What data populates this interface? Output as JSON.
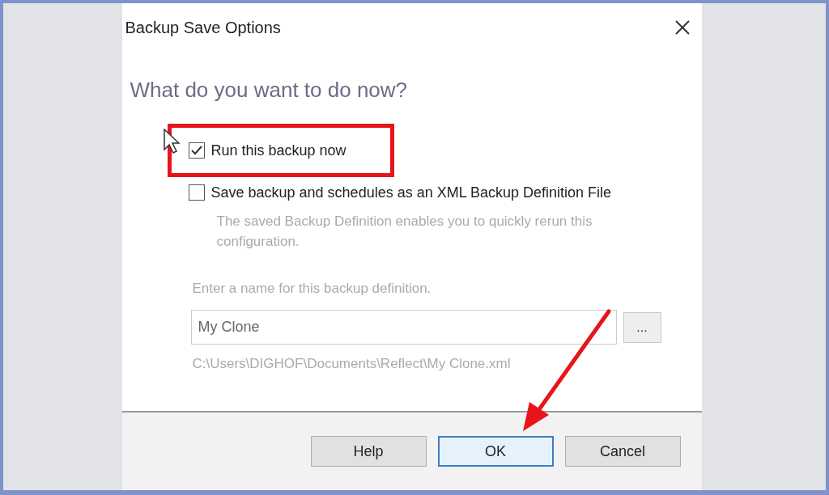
{
  "window": {
    "title": "Backup Save Options"
  },
  "heading": "What do you want to do now?",
  "options": [
    {
      "label": "Run this backup now",
      "checked": true,
      "highlighted": true
    },
    {
      "label": "Save backup and schedules as an XML Backup Definition File",
      "checked": false,
      "highlighted": false
    }
  ],
  "description": "The saved Backup Definition enables you to quickly rerun this configuration.",
  "name_field": {
    "label": "Enter a name for this backup definition.",
    "value": "My Clone",
    "browse": "..."
  },
  "path": "C:\\Users\\DIGHOF\\Documents\\Reflect\\My Clone.xml",
  "buttons": [
    {
      "label": "Help",
      "focused": false
    },
    {
      "label": "OK",
      "focused": true
    },
    {
      "label": "Cancel",
      "focused": false
    }
  ]
}
